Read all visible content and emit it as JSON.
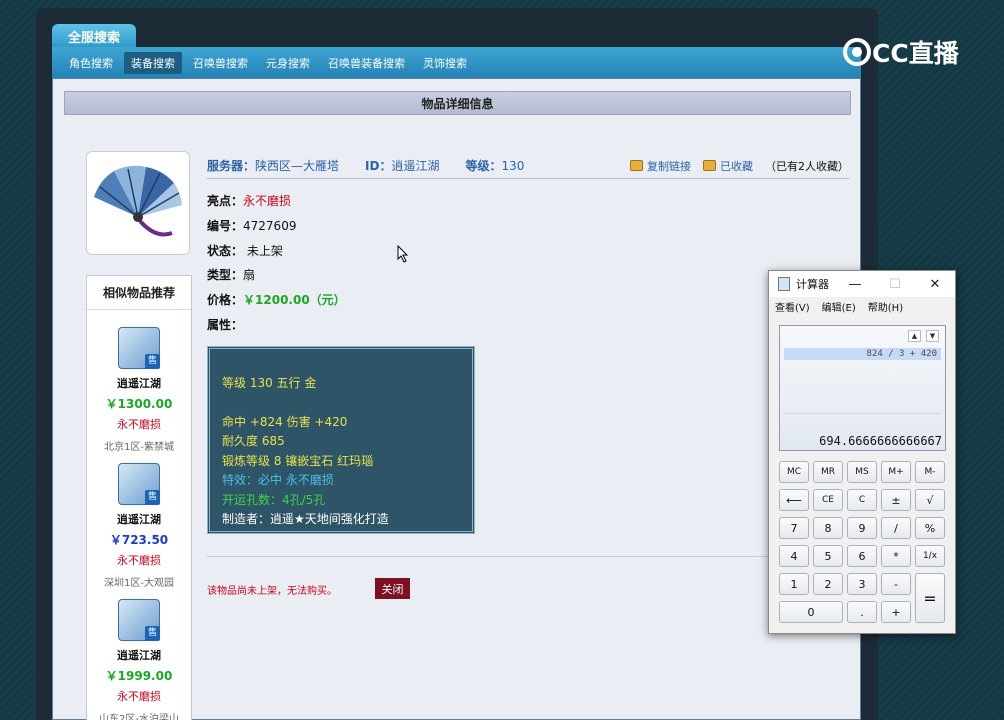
{
  "top_tab": "全服搜索",
  "nav": [
    "角色搜索",
    "装备搜索",
    "召唤兽搜索",
    "元身搜索",
    "召唤兽装备搜索",
    "灵饰搜索"
  ],
  "nav_active": "装备搜索",
  "section_title": "物品详细信息",
  "logo_text": "CC直播",
  "header": {
    "server_label": "服务器：",
    "server_value": "陕西区—大雁塔",
    "id_label": "ID：",
    "id_value": "逍遥江湖",
    "level_label": "等级：",
    "level_value": "130",
    "copy_link": "复制链接",
    "favorited": "已收藏",
    "fav_count": "（已有2人收藏）"
  },
  "details": {
    "highlight_label": "亮点：",
    "highlight_value": "永不磨损",
    "number_label": "编号：",
    "number_value": "4727609",
    "status_label": "状态：",
    "status_value": "未上架",
    "type_label": "类型：",
    "type_value": "扇",
    "price_label": "价格：",
    "price_value": "￥1200.00（元）",
    "attr_label": "属性："
  },
  "attributes": {
    "line1": "等级 130 五行 金",
    "line2": "命中 +824 伤害 +420",
    "line3": "耐久度 685",
    "line4": "锻炼等级 8 镶嵌宝石 红玛瑙",
    "line5": "特效：必中 永不磨损",
    "line6": "开运孔数：4孔/5孔",
    "line7": "制造者：逍遥★天地间强化打造"
  },
  "notice": "该物品尚未上架，无法购买。",
  "close_button": "关闭",
  "sidebar": {
    "title": "相似物品推荐",
    "items": [
      {
        "sale": "售",
        "name": "逍遥江湖",
        "price": "￥1300.00",
        "tag": "永不磨损",
        "server": "北京1区-紫禁城",
        "price_color": "#1ca824"
      },
      {
        "sale": "售",
        "name": "逍遥江湖",
        "price": "￥723.50",
        "tag": "永不磨损",
        "server": "深圳1区-大观园",
        "price_color": "#1c3cc8"
      },
      {
        "sale": "售",
        "name": "逍遥江湖",
        "price": "￥1999.00",
        "tag": "永不磨损",
        "server": "山东2区-水泊梁山",
        "price_color": "#1ca824"
      }
    ]
  },
  "calculator": {
    "title": "计算器",
    "minimize": "—",
    "maximize": "☐",
    "close": "✕",
    "menu": [
      "查看(V)",
      "编辑(E)",
      "帮助(H)"
    ],
    "history_up": "▲",
    "history_down": "▼",
    "expression": "824 / 3 + 420",
    "result": "694.6666666666667",
    "keys": {
      "mc": "MC",
      "mr": "MR",
      "ms": "MS",
      "mplus": "M+",
      "mminus": "M-",
      "back": "⟵",
      "ce": "CE",
      "c": "C",
      "plusminus": "±",
      "sqrt": "√",
      "k7": "7",
      "k8": "8",
      "k9": "9",
      "div": "/",
      "pct": "%",
      "k4": "4",
      "k5": "5",
      "k6": "6",
      "mul": "*",
      "recip": "1/x",
      "k1": "1",
      "k2": "2",
      "k3": "3",
      "sub": "-",
      "eq": "=",
      "k0": "0",
      "dot": ".",
      "add": "+"
    }
  }
}
